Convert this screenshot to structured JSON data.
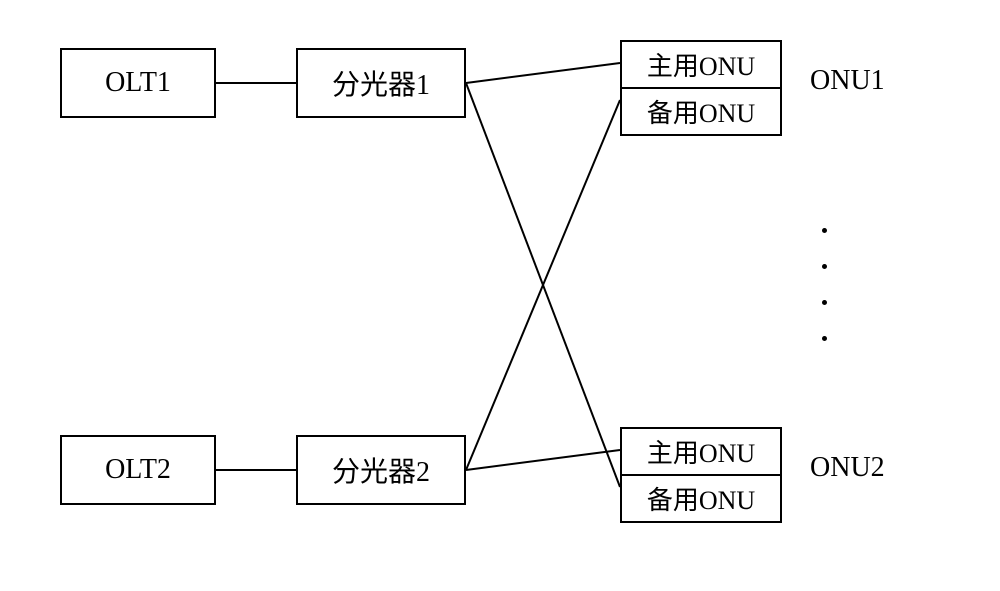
{
  "olt1": "OLT1",
  "olt2": "OLT2",
  "splitter1": "分光器1",
  "splitter2": "分光器2",
  "onu1": {
    "primary": "主用ONU",
    "backup": "备用ONU",
    "label": "ONU1"
  },
  "onu2": {
    "primary": "主用ONU",
    "backup": "备用ONU",
    "label": "ONU2"
  }
}
